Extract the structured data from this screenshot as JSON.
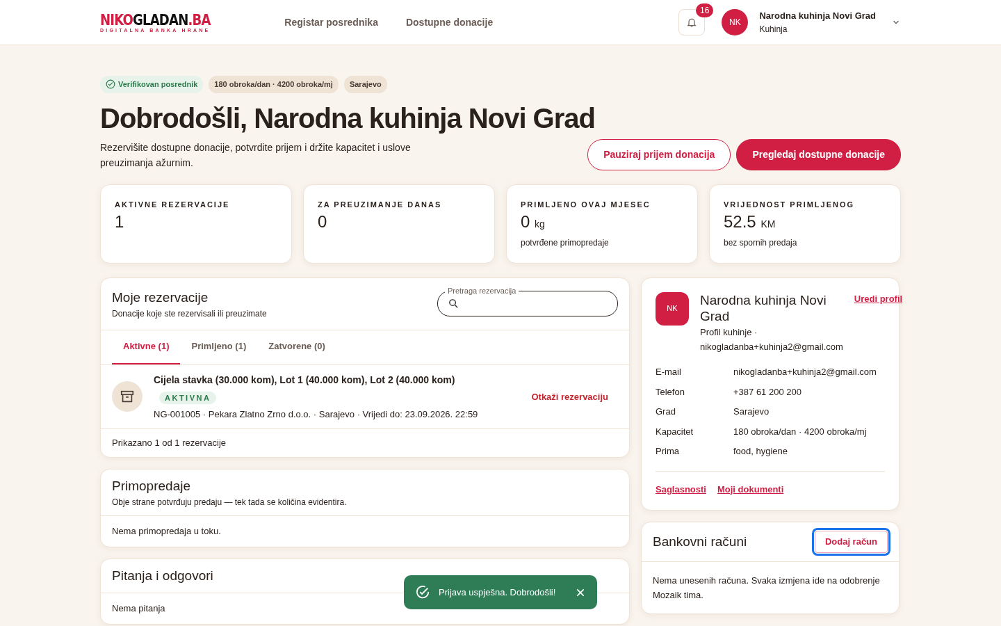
{
  "nav": {
    "logo": {
      "part_red": "NIKO",
      "part_dark": "GLADAN",
      "part_suffix": ".BA",
      "tagline": "DIGITALNA BANKA HRANE"
    },
    "links": [
      "Registar posrednika",
      "Dostupne donacije"
    ],
    "notifications": {
      "count": "16"
    },
    "user": {
      "initials": "NK",
      "name": "Narodna kuhinja Novi Grad",
      "role": "Kuhinja"
    }
  },
  "hero": {
    "badges": [
      {
        "kind": "verified",
        "label": "Verifikovan posrednik"
      },
      {
        "kind": "plain",
        "label": "180 obroka/dan · 4200 obroka/mj"
      },
      {
        "kind": "plain",
        "label": "Sarajevo"
      }
    ],
    "title": "Dobrodošli, Narodna kuhinja Novi Grad",
    "subtitle": "Rezervišite dostupne donacije, potvrdite prijem i držite kapacitet i uslove preuzimanja ažurnim.",
    "buttons": [
      {
        "kind": "outline",
        "label": "Pauziraj prijem donacija"
      },
      {
        "kind": "primary",
        "label": "Pregledaj dostupne donacije"
      }
    ]
  },
  "stats": [
    {
      "label": "AKTIVNE REZERVACIJE",
      "value": "1"
    },
    {
      "label": "ZA PREUZIMANJE DANAS",
      "value": "0"
    },
    {
      "label": "PRIMLJENO OVAJ MJESEC",
      "value": "0",
      "unit": "kg",
      "note": "potvrđene primopredaje"
    },
    {
      "label": "VRIJEDNOST PRIMLJENOG",
      "value": "52.5",
      "unit": "KM",
      "note": "bez spornih predaja"
    }
  ],
  "reservations": {
    "title": "Moje rezervacije",
    "subtitle": "Donacije koje ste rezervisali ili preuzimate",
    "search": {
      "label": "Pretraga rezervacija"
    },
    "tabs": [
      {
        "label": "Aktivne (1)",
        "selected": true
      },
      {
        "label": "Primljeno (1)",
        "selected": false
      },
      {
        "label": "Zatvorene (0)",
        "selected": false
      }
    ],
    "items": [
      {
        "title": "Cijela stavka (30.000 kom), Lot 1 (40.000 kom), Lot 2 (40.000 kom)",
        "status": "AKTIVNA",
        "meta": "NG-001005 · Pekara Zlatno Zrno d.o.o. · Sarajevo · Vrijedi do: 23.09.2026. 22:59",
        "action": "Otkaži rezervaciju"
      }
    ],
    "footer": "Prikazano 1 od 1 rezervacije"
  },
  "handovers": {
    "title": "Primopredaje",
    "subtitle": "Obje strane potvrđuju predaju — tek tada se količina evidentira.",
    "empty": "Nema primopredaja u toku."
  },
  "qa": {
    "title": "Pitanja i odgovori",
    "empty": "Nema pitanja"
  },
  "profile": {
    "initials": "NK",
    "name": "Narodna kuhinja Novi Grad",
    "subtitle": "Profil kuhinje · nikogladanba+kuhinja2@gmail.com",
    "edit_link": "Uredi profil",
    "fields": [
      {
        "label": "E-mail",
        "value": "nikogladanba+kuhinja2@gmail.com"
      },
      {
        "label": "Telefon",
        "value": "+387 61 200 200"
      },
      {
        "label": "Grad",
        "value": "Sarajevo"
      },
      {
        "label": "Kapacitet",
        "value": "180 obroka/dan · 4200 obroka/mj"
      },
      {
        "label": "Prima",
        "value": "food, hygiene"
      }
    ],
    "links": [
      "Saglasnosti",
      "Moji dokumenti"
    ]
  },
  "bank": {
    "title": "Bankovni računi",
    "add_button": {
      "label": "Dodaj račun",
      "focused": true
    },
    "empty": "Nema unesenih računa. Svaka izmjena ide na odobrenje Mozaik tima."
  },
  "toast": {
    "message": "Prijava uspješna. Dobrodošli!"
  }
}
